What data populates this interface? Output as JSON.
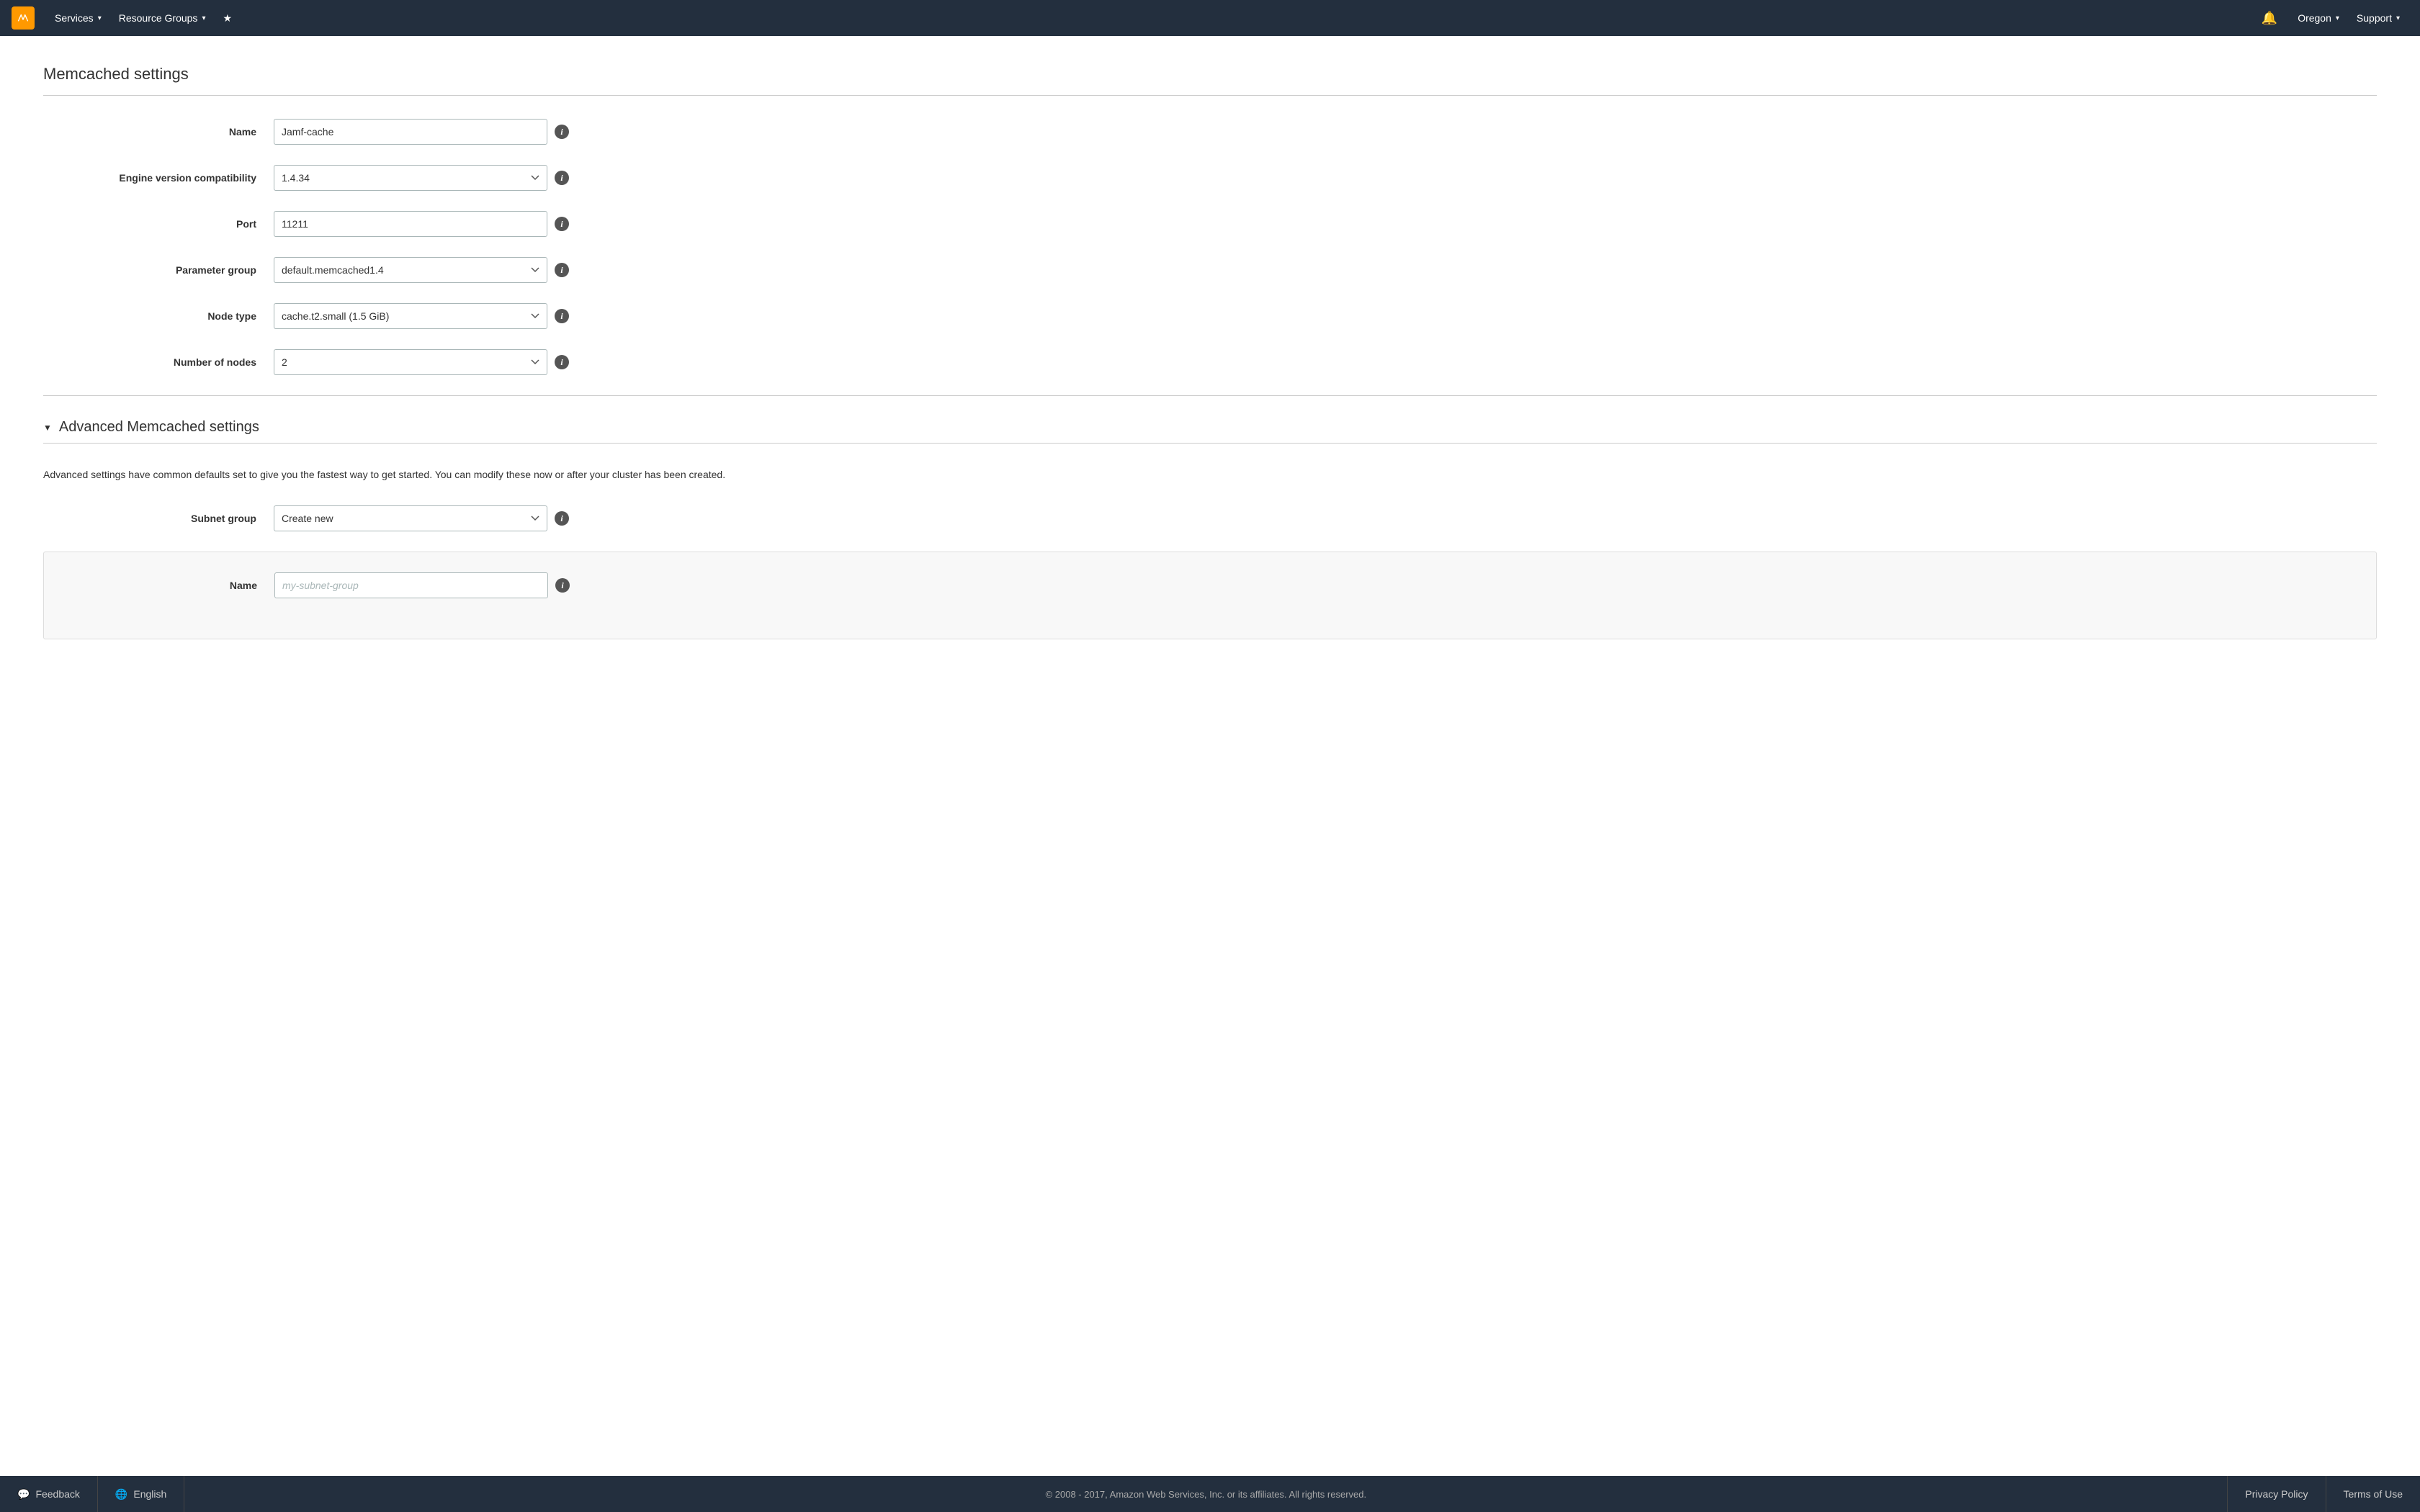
{
  "navbar": {
    "logo_alt": "AWS Logo",
    "services_label": "Services",
    "resource_groups_label": "Resource Groups",
    "region_label": "Oregon",
    "support_label": "Support"
  },
  "page": {
    "section_title": "Memcached settings",
    "fields": {
      "name_label": "Name",
      "name_value": "Jamf-cache",
      "engine_label": "Engine version compatibility",
      "engine_value": "1.4.34",
      "port_label": "Port",
      "port_value": "11211",
      "param_label": "Parameter group",
      "param_value": "default.memcached1.4",
      "node_label": "Node type",
      "node_value": "cache.t2.small (1.5 GiB)",
      "nodes_label": "Number of nodes",
      "nodes_value": "2"
    },
    "advanced": {
      "title": "Advanced Memcached settings",
      "description": "Advanced settings have common defaults set to give you the fastest way to get started. You can modify these now or after your cluster has been created.",
      "subnet_label": "Subnet group",
      "subnet_value": "Create new",
      "subnet_name_label": "Name",
      "subnet_name_placeholder": "my-subnet-group"
    }
  },
  "footer": {
    "feedback_label": "Feedback",
    "language_label": "English",
    "copyright": "© 2008 - 2017, Amazon Web Services, Inc. or its affiliates. All rights reserved.",
    "privacy_label": "Privacy Policy",
    "terms_label": "Terms of Use"
  }
}
